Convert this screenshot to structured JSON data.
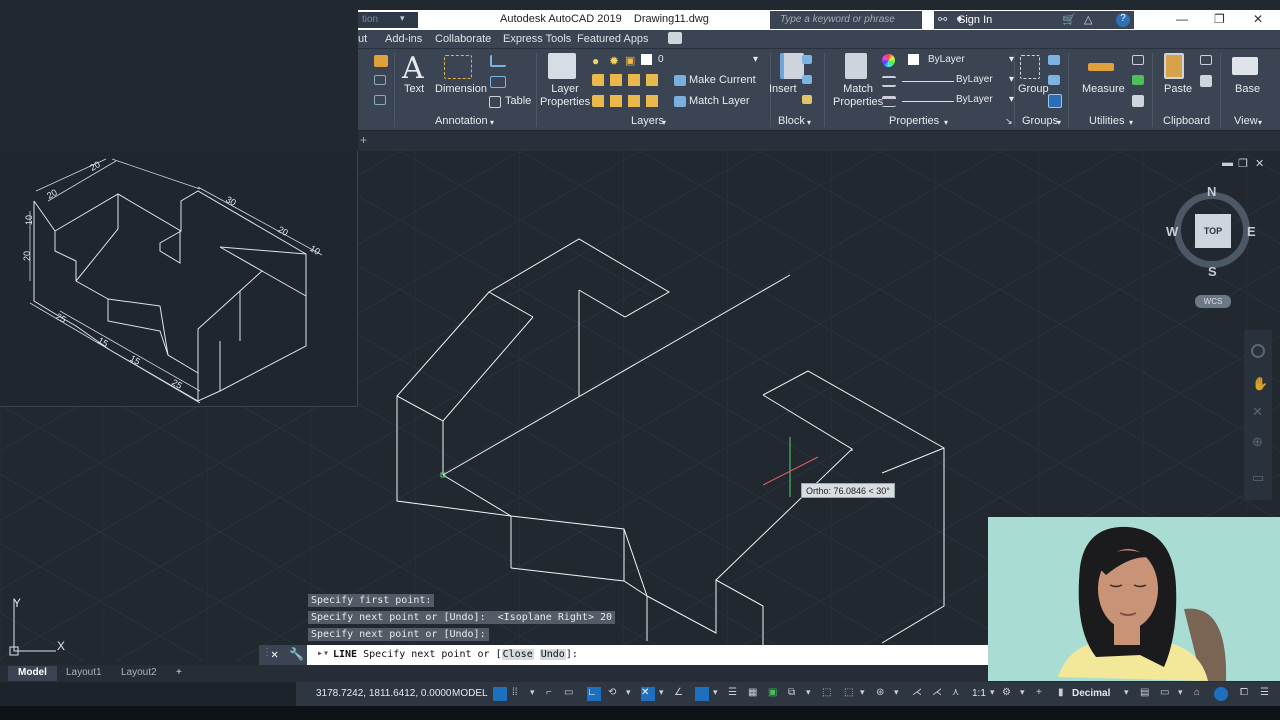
{
  "app": {
    "title": "Autodesk AutoCAD 2019    Drawing11.dwg",
    "search_placeholder": "Type a keyword or phrase",
    "sign_in": "Sign In",
    "quick_access_text": "tion"
  },
  "ribbon_tabs": [
    "ut",
    "Add-ins",
    "Collaborate",
    "Express Tools",
    "Featured Apps"
  ],
  "ribbon": {
    "annotation": {
      "text": "Text",
      "dimension": "Dimension",
      "table": "Table",
      "panel": "Annotation"
    },
    "layers": {
      "layer_properties": "Layer\nProperties",
      "layer_name": "0",
      "make_current": "Make Current",
      "match_layer": "Match Layer",
      "panel": "Layers"
    },
    "block": {
      "insert": "Insert",
      "panel": "Block"
    },
    "properties": {
      "match_properties": "Match\nProperties",
      "color": "ByLayer",
      "linetype": "ByLayer",
      "lineweight": "ByLayer",
      "panel": "Properties"
    },
    "groups": {
      "group": "Group",
      "panel": "Groups"
    },
    "utilities": {
      "measure": "Measure",
      "panel": "Utilities"
    },
    "clipboard": {
      "paste": "Paste",
      "panel": "Clipboard"
    },
    "view": {
      "base": "Base",
      "panel": "View"
    }
  },
  "viewcube": {
    "n": "N",
    "s": "S",
    "e": "E",
    "w": "W",
    "face": "TOP",
    "wcs": "WCS"
  },
  "ucs": {
    "x": "X",
    "y": "Y"
  },
  "thumbnail_dims": [
    "20",
    "20",
    "30",
    "20",
    "10",
    "10",
    "20",
    "25",
    "15",
    "15",
    "25"
  ],
  "tooltip": "Ortho: 76.0846 < 30°",
  "command_history": [
    "Specify first point:",
    "Specify next point or [Undo]:  <Isoplane Right> 20",
    "Specify next point or [Undo]:"
  ],
  "command_line": {
    "command": "LINE",
    "prompt": "Specify next point or [",
    "opt1": "Close",
    "opt2": "Undo",
    "end": "]:"
  },
  "layout_tabs": [
    "Model",
    "Layout1",
    "Layout2"
  ],
  "status": {
    "coords": "3178.7242, 1811.6412, 0.0000",
    "space": "MODEL",
    "scale": "1:1",
    "units": "Decimal"
  }
}
